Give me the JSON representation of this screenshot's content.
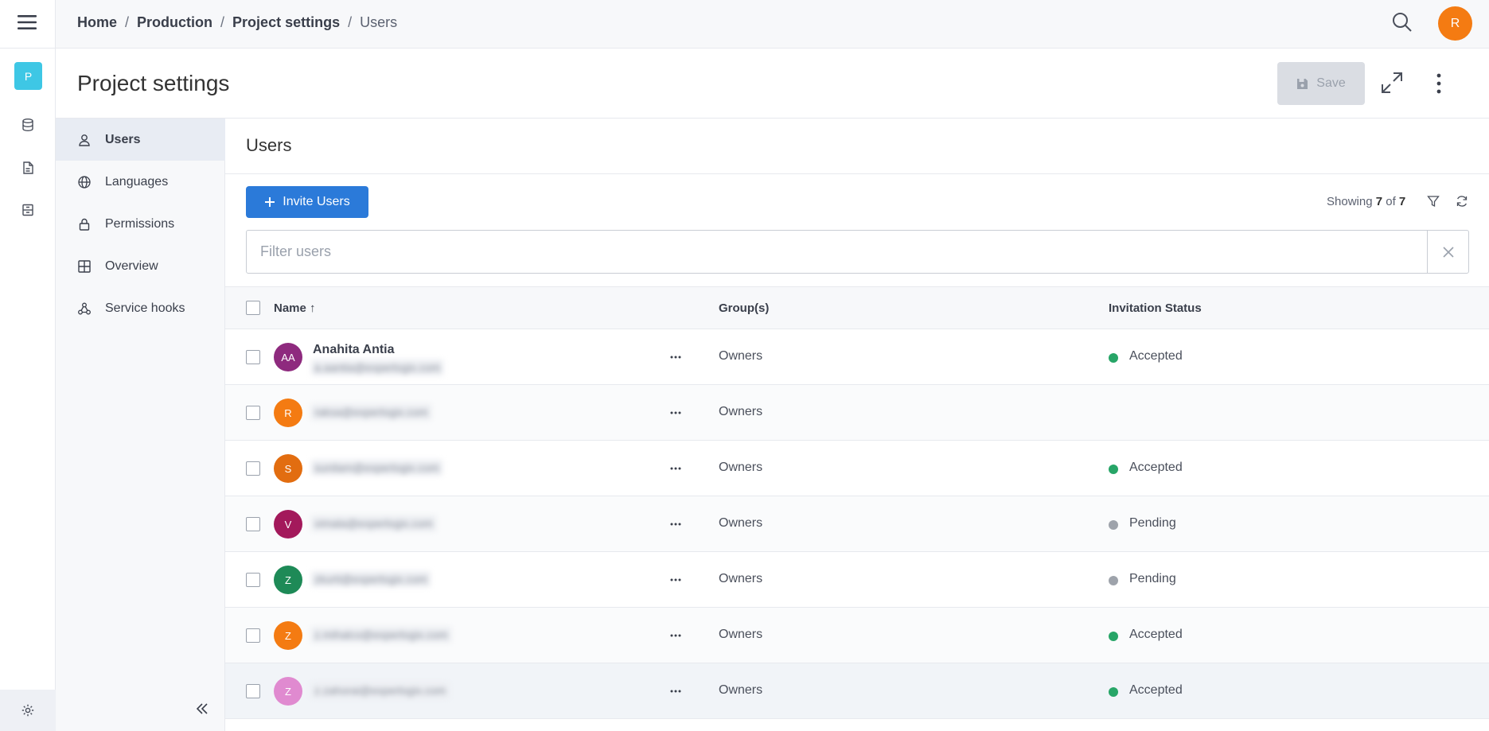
{
  "rail": {
    "project_initial": "P",
    "project_color": "#3ec7e5",
    "icons": [
      "menu-icon",
      "database-icon",
      "document-icon",
      "archive-icon",
      "settings-icon"
    ]
  },
  "breadcrumb": {
    "home": "Home",
    "production": "Production",
    "project_settings": "Project settings",
    "current": "Users",
    "separator": "/"
  },
  "topbar": {
    "user_initial": "R",
    "user_color": "#f47b12"
  },
  "header": {
    "title": "Project settings",
    "save_label": "Save"
  },
  "nav": {
    "items": [
      {
        "label": "Users",
        "icon": "user-icon",
        "active": true
      },
      {
        "label": "Languages",
        "icon": "globe-icon",
        "active": false
      },
      {
        "label": "Permissions",
        "icon": "lock-icon",
        "active": false
      },
      {
        "label": "Overview",
        "icon": "grid-icon",
        "active": false
      },
      {
        "label": "Service hooks",
        "icon": "webhook-icon",
        "active": false
      }
    ]
  },
  "section": {
    "title": "Users",
    "invite_label": "Invite Users",
    "showing_prefix": "Showing",
    "showing_count": "7",
    "showing_of": "of",
    "showing_total": "7",
    "filter_placeholder": "Filter users"
  },
  "table": {
    "columns": {
      "name": "Name",
      "sort_arrow": "↑",
      "groups": "Group(s)",
      "status": "Invitation Status"
    },
    "rows": [
      {
        "initials": "AA",
        "avatar_color": "#8e2a7e",
        "name": "Anahita Antia",
        "email": "a.aantia@experlogix.com",
        "group": "Owners",
        "status": "Accepted",
        "status_color": "#27a567"
      },
      {
        "initials": "R",
        "avatar_color": "#f47b12",
        "name": "",
        "email": "raksa@experlogix.com",
        "group": "Owners",
        "status": "",
        "status_color": ""
      },
      {
        "initials": "S",
        "avatar_color": "#e26d10",
        "name": "",
        "email": "sunilam@experlogix.com",
        "group": "Owners",
        "status": "Accepted",
        "status_color": "#27a567"
      },
      {
        "initials": "V",
        "avatar_color": "#a3195b",
        "name": "",
        "email": "vimala@experlogix.com",
        "group": "Owners",
        "status": "Pending",
        "status_color": "#9ea3ab"
      },
      {
        "initials": "Z",
        "avatar_color": "#1e8a57",
        "name": "",
        "email": "zkurti@experlogix.com",
        "group": "Owners",
        "status": "Pending",
        "status_color": "#9ea3ab"
      },
      {
        "initials": "Z",
        "avatar_color": "#f47b12",
        "name": "",
        "email": "z.mihalco@experlogix.com",
        "group": "Owners",
        "status": "Accepted",
        "status_color": "#27a567"
      },
      {
        "initials": "Z",
        "avatar_color": "#e08ad0",
        "name": "",
        "email": "z.zahorai@experlogix.com",
        "group": "Owners",
        "status": "Accepted",
        "status_color": "#27a567"
      }
    ]
  }
}
